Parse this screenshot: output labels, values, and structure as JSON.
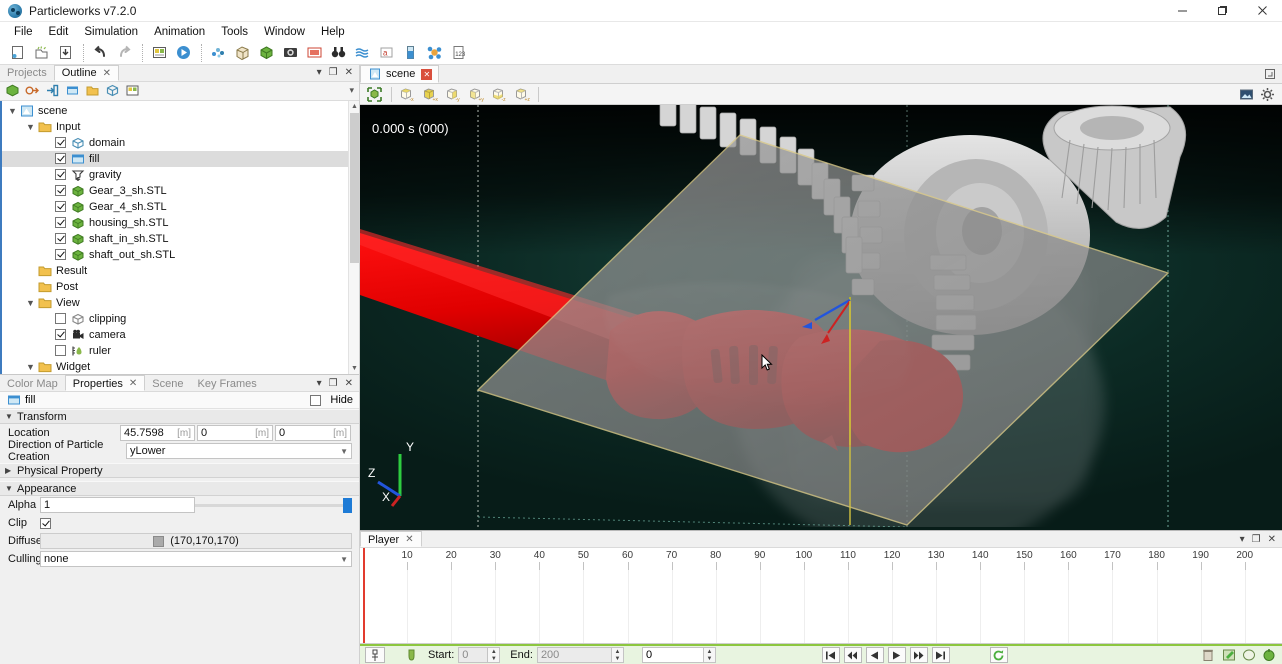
{
  "window": {
    "title": "Particleworks v7.2.0",
    "app_icon": "particleworks-logo-icon",
    "minimize": "–",
    "maximize": "❐",
    "close": "✕"
  },
  "menubar": {
    "items": [
      {
        "label": "File"
      },
      {
        "label": "Edit"
      },
      {
        "label": "Simulation"
      },
      {
        "label": "Animation"
      },
      {
        "label": "Tools"
      },
      {
        "label": "Window"
      },
      {
        "label": "Help"
      }
    ]
  },
  "toolbar": {
    "groups": [
      {
        "buttons": [
          {
            "name": "new-project-icon",
            "label": "New"
          },
          {
            "name": "open-project-icon",
            "label": "Open"
          },
          {
            "name": "save-project-icon",
            "label": "Save"
          }
        ]
      },
      {
        "buttons": [
          {
            "name": "undo-icon",
            "label": "Undo"
          },
          {
            "name": "redo-icon",
            "label": "Redo"
          }
        ]
      },
      {
        "buttons": [
          {
            "name": "setup-simulation-icon",
            "label": "Setup Simulation"
          },
          {
            "name": "run-simulation-icon",
            "label": "Run Simulation"
          }
        ]
      },
      {
        "buttons": [
          {
            "name": "particle-icon",
            "label": "Particle"
          },
          {
            "name": "box-wireframe-icon",
            "label": "Box"
          },
          {
            "name": "green-cube-icon",
            "label": "Solid"
          },
          {
            "name": "camera-icon",
            "label": "Camera"
          },
          {
            "name": "movie-icon",
            "label": "Movie"
          },
          {
            "name": "binoculars-icon",
            "label": "View"
          },
          {
            "name": "waves-icon",
            "label": "Flow"
          },
          {
            "name": "text-annotation-icon",
            "label": "Annotation"
          },
          {
            "name": "beaker-icon",
            "label": "Fluid"
          },
          {
            "name": "molecule-icon",
            "label": "Molecule"
          },
          {
            "name": "numbers-icon",
            "label": "Numbers"
          }
        ]
      }
    ]
  },
  "outline_panel": {
    "tabs": [
      {
        "label": "Projects",
        "active": false,
        "closable": false
      },
      {
        "label": "Outline",
        "active": true,
        "closable": true
      }
    ],
    "dock_controls": [
      "chevron-down-icon",
      "float-icon",
      "close-icon"
    ],
    "toolbar_buttons": [
      {
        "name": "add-scene-icon"
      },
      {
        "name": "import-icon"
      },
      {
        "name": "export-icon"
      },
      {
        "name": "fill-icon"
      },
      {
        "name": "folder-icon"
      },
      {
        "name": "domain-icon"
      },
      {
        "name": "settings-tree-icon"
      }
    ],
    "tree": [
      {
        "label": "scene",
        "indent": 0,
        "twisty": "open",
        "checkbox": null,
        "icon": "scene-icon",
        "selected": false
      },
      {
        "label": "Input",
        "indent": 1,
        "twisty": "open",
        "checkbox": null,
        "icon": "folder-icon",
        "selected": false
      },
      {
        "label": "domain",
        "indent": 2,
        "twisty": null,
        "checkbox": true,
        "icon": "domain-icon",
        "selected": false
      },
      {
        "label": "fill",
        "indent": 2,
        "twisty": null,
        "checkbox": true,
        "icon": "fill-icon",
        "selected": true
      },
      {
        "label": "gravity",
        "indent": 2,
        "twisty": null,
        "checkbox": true,
        "icon": "gravity-icon",
        "selected": false
      },
      {
        "label": "Gear_3_sh.STL",
        "indent": 2,
        "twisty": null,
        "checkbox": true,
        "icon": "stl-icon",
        "selected": false
      },
      {
        "label": "Gear_4_sh.STL",
        "indent": 2,
        "twisty": null,
        "checkbox": true,
        "icon": "stl-icon",
        "selected": false
      },
      {
        "label": "housing_sh.STL",
        "indent": 2,
        "twisty": null,
        "checkbox": true,
        "icon": "stl-icon",
        "selected": false
      },
      {
        "label": "shaft_in_sh.STL",
        "indent": 2,
        "twisty": null,
        "checkbox": true,
        "icon": "stl-icon",
        "selected": false
      },
      {
        "label": "shaft_out_sh.STL",
        "indent": 2,
        "twisty": null,
        "checkbox": true,
        "icon": "stl-icon",
        "selected": false
      },
      {
        "label": "Result",
        "indent": 1,
        "twisty": null,
        "checkbox": null,
        "icon": "folder-icon",
        "selected": false
      },
      {
        "label": "Post",
        "indent": 1,
        "twisty": null,
        "checkbox": null,
        "icon": "folder-icon",
        "selected": false
      },
      {
        "label": "View",
        "indent": 1,
        "twisty": "open",
        "checkbox": null,
        "icon": "folder-icon",
        "selected": false
      },
      {
        "label": "clipping",
        "indent": 2,
        "twisty": null,
        "checkbox": false,
        "icon": "clipping-icon",
        "selected": false
      },
      {
        "label": "camera",
        "indent": 2,
        "twisty": null,
        "checkbox": true,
        "icon": "camera-icon",
        "selected": false
      },
      {
        "label": "ruler",
        "indent": 2,
        "twisty": null,
        "checkbox": false,
        "icon": "ruler-icon",
        "selected": false
      },
      {
        "label": "Widget",
        "indent": 1,
        "twisty": "open",
        "checkbox": null,
        "icon": "folder-icon",
        "selected": false
      }
    ]
  },
  "properties_panel": {
    "tabs": [
      {
        "label": "Color Map",
        "active": false,
        "closable": false
      },
      {
        "label": "Properties",
        "active": true,
        "closable": true
      },
      {
        "label": "Scene",
        "active": false,
        "closable": false
      },
      {
        "label": "Key Frames",
        "active": false,
        "closable": false
      }
    ],
    "object": {
      "icon": "fill-icon",
      "name": "fill"
    },
    "hide": {
      "label": "Hide",
      "checked": false
    },
    "sections": [
      {
        "title": "Transform",
        "expanded": true,
        "rows": [
          {
            "label": "Location",
            "type": "triple_field",
            "values": [
              "45.7598",
              "0",
              "0"
            ],
            "unit": "[m]"
          },
          {
            "label": "Direction of Particle Creation",
            "type": "combo",
            "value": "yLower"
          }
        ]
      },
      {
        "title": "Physical Property",
        "expanded": false,
        "rows": []
      },
      {
        "title": "Appearance",
        "expanded": true,
        "rows": [
          {
            "label": "Alpha",
            "type": "field_slider",
            "value": "1"
          },
          {
            "label": "Clip",
            "type": "checkbox",
            "checked": true
          },
          {
            "label": "Diffuse",
            "type": "color",
            "value": "(170,170,170)",
            "color": "#aaaaaa"
          },
          {
            "label": "Culling",
            "type": "combo",
            "value": "none"
          }
        ]
      }
    ]
  },
  "viewport": {
    "tabs": [
      {
        "label": "scene",
        "active": true,
        "close": "✕"
      }
    ],
    "restore_icon": "restore-window-icon",
    "toolbar_buttons": [
      {
        "name": "fit-view-icon"
      },
      {
        "name": "view-minus-x-icon",
        "axis": "-X"
      },
      {
        "name": "view-plus-x-icon",
        "axis": "+X"
      },
      {
        "name": "view-minus-y-icon",
        "axis": "-Y"
      },
      {
        "name": "view-plus-y-icon",
        "axis": "+Y"
      },
      {
        "name": "view-minus-z-icon",
        "axis": "-Z"
      },
      {
        "name": "view-plus-z-icon",
        "axis": "+Z"
      }
    ],
    "toolbar_right": [
      {
        "name": "snapshot-icon"
      },
      {
        "name": "view-settings-gear-icon"
      }
    ],
    "time_label": "0.000 s (000)",
    "axes": {
      "x": "X",
      "y": "Y",
      "z": "Z",
      "x_color": "#cc2222",
      "y_color": "#2ecc40",
      "z_color": "#2255dd"
    },
    "background_color": "#0c3029",
    "fluid_color": "#e00000",
    "solid_color": "#b8b8b8",
    "domain_edge_color": "#d8c88a"
  },
  "player_panel": {
    "tabs": [
      {
        "label": "Player",
        "active": true,
        "close": "✕"
      }
    ],
    "dock_controls": [
      "chevron-down-icon",
      "float-icon",
      "close-icon"
    ],
    "timeline": {
      "ticks": [
        10,
        20,
        30,
        40,
        50,
        60,
        70,
        80,
        90,
        100,
        110,
        120,
        130,
        140,
        150,
        160,
        170,
        180,
        190,
        200
      ],
      "playhead": 0
    },
    "controls": {
      "key_icon": "key-frame-icon",
      "range_icon": "range-icon",
      "start_label": "Start:",
      "start_value": "0",
      "end_label": "End:",
      "end_value": "200",
      "current_value": "0",
      "buttons": [
        {
          "name": "go-to-start-button",
          "glyph": "⏮"
        },
        {
          "name": "step-back-fast-button",
          "glyph": "⏪"
        },
        {
          "name": "play-reverse-button",
          "glyph": "◀"
        },
        {
          "name": "play-button",
          "glyph": "▶"
        },
        {
          "name": "step-forward-fast-button",
          "glyph": "⏩"
        },
        {
          "name": "go-to-end-button",
          "glyph": "⏭"
        }
      ],
      "loop_button": "loop-icon",
      "right_buttons": [
        {
          "name": "delete-icon"
        },
        {
          "name": "record-icon"
        },
        {
          "name": "capture-icon"
        },
        {
          "name": "render-icon"
        }
      ]
    }
  }
}
